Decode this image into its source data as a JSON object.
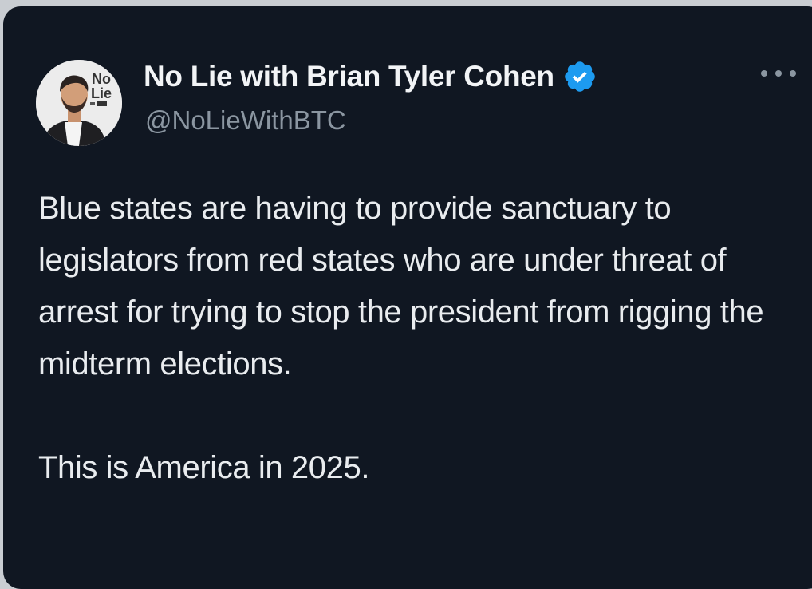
{
  "post": {
    "author": {
      "display_name": "No Lie with Brian Tyler Cohen",
      "handle": "@NoLieWithBTC",
      "avatar_icon": "profile-photo-avatar",
      "avatar_logo_text": "No Lie",
      "verified": true,
      "verified_icon": "verified-badge-icon",
      "verified_color": "#1d9bf0"
    },
    "more_icon": "more-options-icon",
    "text_paragraphs": [
      "Blue states are having to provide sanctuary to legislators from red states who are under threat of arrest for trying to stop the president from rigging the midterm elections.",
      "This is America in 2025."
    ]
  },
  "colors": {
    "card_background": "#101722",
    "page_background": "#c9cdd2",
    "primary_text": "#e9ecef",
    "secondary_text": "#8b96a1"
  }
}
